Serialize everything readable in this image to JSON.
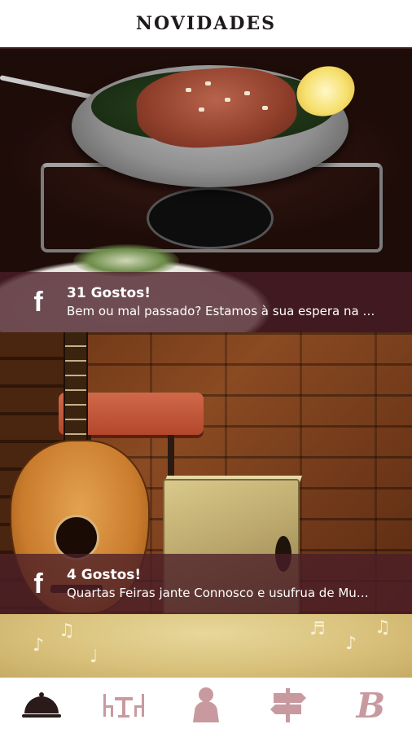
{
  "header": {
    "title": "NOVIDADES"
  },
  "posts": [
    {
      "likes": "31 Gostos!",
      "message": "Bem ou mal passado? Estamos à sua espera na …",
      "source_icon": "facebook-icon"
    },
    {
      "likes": "4 Gostos!",
      "message": "Quartas Feiras jante Connosco e usufrua de Mu…",
      "source_icon": "facebook-icon"
    }
  ],
  "fb_glyph": "f",
  "tabbar": {
    "items": [
      {
        "name": "news",
        "icon": "cloche-icon",
        "active": true
      },
      {
        "name": "menu",
        "icon": "dining-table-icon",
        "active": false
      },
      {
        "name": "profile",
        "icon": "person-icon",
        "active": false
      },
      {
        "name": "directions",
        "icon": "signpost-icon",
        "active": false
      },
      {
        "name": "brand",
        "icon": "brand-b-icon",
        "glyph": "B",
        "active": false
      }
    ]
  },
  "colors": {
    "header_rule": "#3a1e22",
    "caption_overlay": "#4a1e28",
    "tab_active": "#2a1a1a",
    "tab_inactive": "#c89aa0"
  }
}
